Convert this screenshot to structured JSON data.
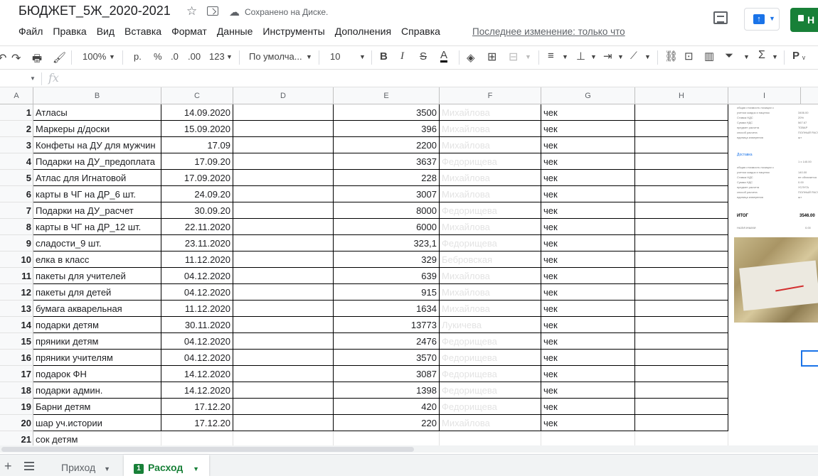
{
  "doc": {
    "title": "БЮДЖЕТ_5Ж_2020-2021",
    "save_status": "Сохранено на Диске.",
    "share_label": "Н"
  },
  "menu": [
    "Файл",
    "Правка",
    "Вид",
    "Вставка",
    "Формат",
    "Данные",
    "Инструменты",
    "Дополнения",
    "Справка"
  ],
  "last_edit": "Последнее изменение: только что",
  "toolbar": {
    "zoom": "100%",
    "currency": "р.",
    "percent": "%",
    "dec_less": ".0",
    "dec_more": ".00",
    "more_formats": "123",
    "font": "По умолча...",
    "font_size": "10",
    "bold": "B",
    "italic": "I",
    "strike": "S",
    "text_color": "A",
    "cyrillic": "Р"
  },
  "columns": [
    "A",
    "B",
    "C",
    "D",
    "E",
    "F",
    "G",
    "H",
    "I"
  ],
  "rows": [
    {
      "n": "1",
      "item": "Атласы",
      "date": "14.09.2020",
      "amount": "3500",
      "person": "Михайлова",
      "doc": "чек"
    },
    {
      "n": "2",
      "item": "Маркеры д/доски",
      "date": "15.09.2020",
      "amount": "396",
      "person": "Михайлова",
      "doc": "чек"
    },
    {
      "n": "3",
      "item": "Конфеты на ДУ для мужчин",
      "date": "17.09",
      "amount": "2200",
      "person": "Михайлова",
      "doc": "чек"
    },
    {
      "n": "4",
      "item": "Подарки на ДУ_предоплата",
      "date": "17.09.20",
      "amount": "3637",
      "person": "Федорищева",
      "doc": "чек"
    },
    {
      "n": "5",
      "item": "Атлас для Игнатовой",
      "date": "17.09.2020",
      "amount": "228",
      "person": "Михайлова",
      "doc": "чек"
    },
    {
      "n": "6",
      "item": "карты в ЧГ на ДР_6 шт.",
      "date": "24.09.20",
      "amount": "3007",
      "person": "Михайлова",
      "doc": "чек"
    },
    {
      "n": "7",
      "item": "Подарки на ДУ_расчет",
      "date": "30.09.20",
      "amount": "8000",
      "person": "Федорищева",
      "doc": "чек"
    },
    {
      "n": "8",
      "item": "карты в ЧГ на ДР_12 шт.",
      "date": "22.11.2020",
      "amount": "6000",
      "person": "Михайлова",
      "doc": "чек"
    },
    {
      "n": "9",
      "item": "сладости_9 шт.",
      "date": "23.11.2020",
      "amount": "323,1",
      "person": "Федорищева",
      "doc": "чек"
    },
    {
      "n": "10",
      "item": "елка в класс",
      "date": "11.12.2020",
      "amount": "329",
      "person": "Бебровская",
      "doc": "чек"
    },
    {
      "n": "11",
      "item": "пакеты для учителей",
      "date": "04.12.2020",
      "amount": "639",
      "person": "Михайлова",
      "doc": "чек"
    },
    {
      "n": "12",
      "item": "пакеты для детей",
      "date": "04.12.2020",
      "amount": "915",
      "person": "Михайлова",
      "doc": "чек"
    },
    {
      "n": "13",
      "item": "бумага акварельная",
      "date": "11.12.2020",
      "amount": "1634",
      "person": "Михайлова",
      "doc": "чек"
    },
    {
      "n": "14",
      "item": "подарки детям",
      "date": "30.11.2020",
      "amount": "13773",
      "person": "Лукичева",
      "doc": "чек"
    },
    {
      "n": "15",
      "item": "пряники детям",
      "date": "04.12.2020",
      "amount": "2476",
      "person": "Федорищева",
      "doc": "чек"
    },
    {
      "n": "16",
      "item": "пряники учителям",
      "date": "04.12.2020",
      "amount": "3570",
      "person": "Федорищева",
      "doc": "чек"
    },
    {
      "n": "17",
      "item": "подарок ФН",
      "date": "14.12.2020",
      "amount": "3087",
      "person": "Федорищева",
      "doc": "чек"
    },
    {
      "n": "18",
      "item": "подарки админ.",
      "date": "14.12.2020",
      "amount": "1398",
      "person": "Федорищева",
      "doc": "чек"
    },
    {
      "n": "19",
      "item": "Барни детям",
      "date": "17.12.20",
      "amount": "420",
      "person": "Федорищева",
      "doc": "чек"
    },
    {
      "n": "20",
      "item": "шар уч.истории",
      "date": "17.12.20",
      "amount": "220",
      "person": "Михайлова",
      "doc": "чек"
    },
    {
      "n": "21",
      "item": "сок детям",
      "date": "",
      "amount": "",
      "person": "",
      "doc": ""
    }
  ],
  "receipt": {
    "lines_top": [
      "общая стоимость позиции с",
      "учетом скидок и наценок",
      "Ставка НДС",
      "Сумма НДС",
      "предмет расчета",
      "способ расчета",
      "единица измерения"
    ],
    "values_top": [
      "3406.00",
      "20%",
      "567.67",
      "ТОВАР",
      "ПОЛНЫЙ РАСЧЕТ",
      "шт"
    ],
    "delivery": "Доставка",
    "delivery_qty": "1 х 140.00",
    "lines_mid": [
      "общая стоимость позиции с",
      "учетом скидок и наценок",
      "Ставка НДС",
      "Сумма НДС",
      "предмет расчета",
      "способ расчета",
      "единица измерения"
    ],
    "values_mid": [
      "140.00",
      "не облагается",
      "0.00",
      "УСЛУГА",
      "ПОЛНЫЙ РАСЧЕТ",
      "шт"
    ],
    "total_label": "ИТОГ",
    "total_value": "3546.00",
    "cash_label": "НАЛИЧНЫМИ",
    "cash_value": "0.00"
  },
  "sheets": {
    "tab1": "Приход",
    "tab2": "Расход",
    "tab2_num": "1"
  }
}
